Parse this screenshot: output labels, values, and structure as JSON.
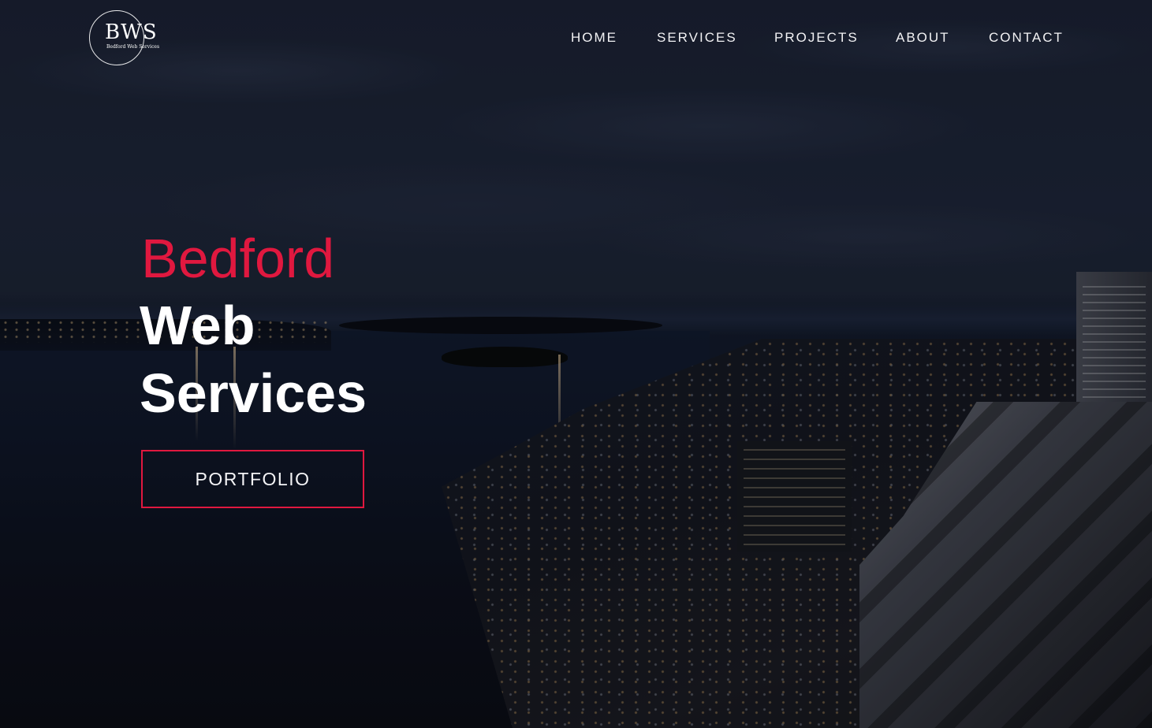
{
  "logo": {
    "mark": "BWS",
    "subtitle": "Bedford Web Services"
  },
  "nav": {
    "items": [
      {
        "label": "HOME"
      },
      {
        "label": "SERVICES"
      },
      {
        "label": "PROJECTS"
      },
      {
        "label": "ABOUT"
      },
      {
        "label": "CONTACT"
      }
    ]
  },
  "hero": {
    "line1": "Bedford",
    "line2": "Web",
    "line3": "Services",
    "button_label": "PORTFOLIO"
  },
  "colors": {
    "accent": "#e0183f",
    "text": "#ffffff",
    "background": "#0d0e17"
  }
}
